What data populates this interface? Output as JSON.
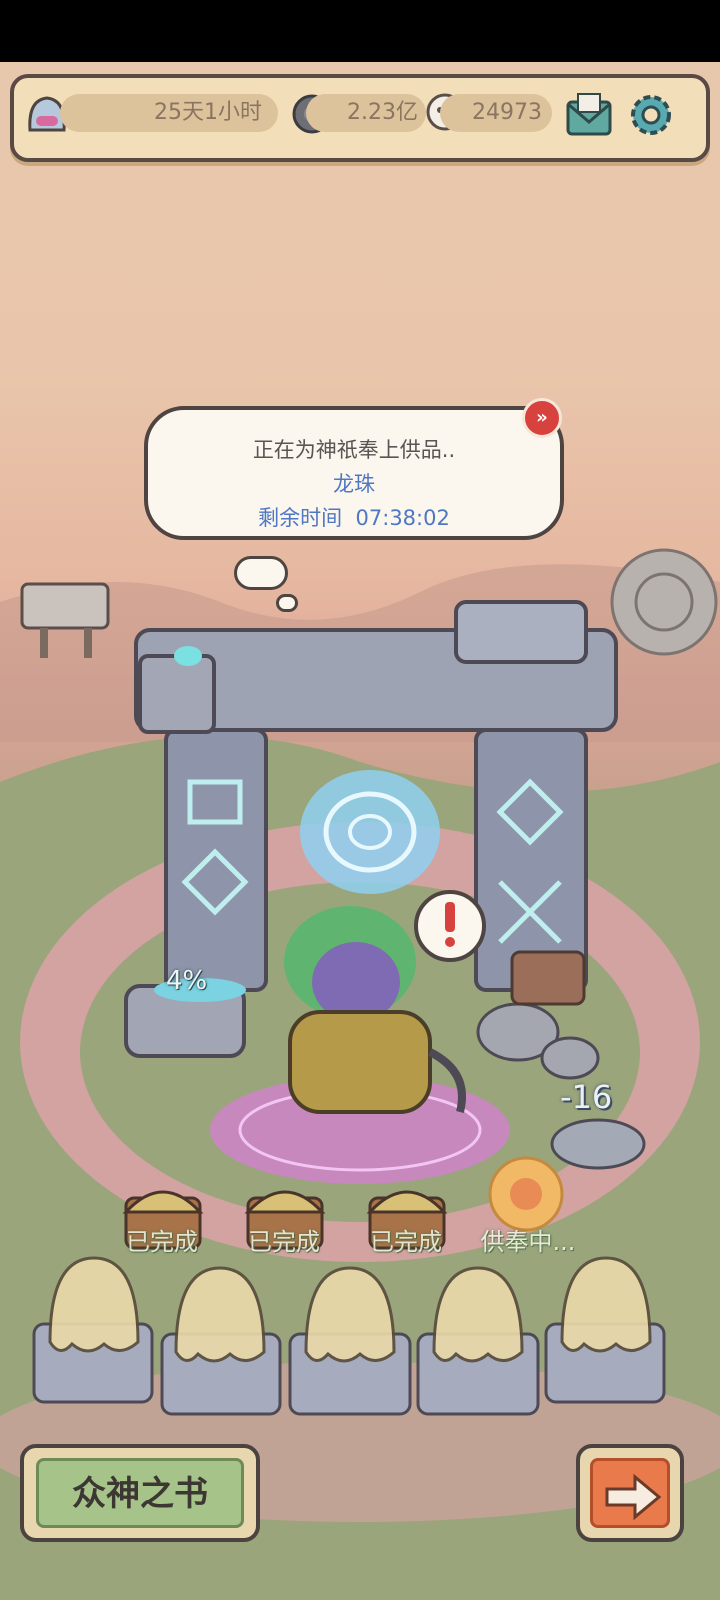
{
  "header": {
    "time_remaining": "25天1小时",
    "coins": "2.23亿",
    "souls": "24973"
  },
  "offering": {
    "status_text": "正在为神祇奉上供品..",
    "item_name": "龙珠",
    "time_label": "剩余时间",
    "time_value": "07:38:02"
  },
  "altar_progress": "4%",
  "score_delta": "-16",
  "slots": [
    {
      "label": "已完成"
    },
    {
      "label": "已完成"
    },
    {
      "label": "已完成"
    },
    {
      "label": "供奉中..."
    }
  ],
  "bottom": {
    "book_button": "众神之书"
  },
  "colors": {
    "bar_bg": "#f2dfb9",
    "bubble_text": "#4f77c4",
    "skip_red": "#d8423e",
    "book_green": "#a6c48a",
    "arrow_orange": "#e87a4c"
  }
}
